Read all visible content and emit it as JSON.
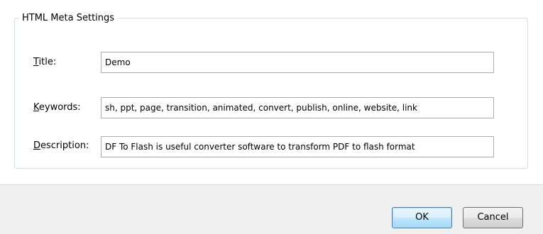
{
  "group": {
    "legend": "HTML Meta Settings"
  },
  "fields": {
    "title": {
      "mnemonic": "T",
      "label_rest": "itle:",
      "value": "Demo"
    },
    "keywords": {
      "mnemonic": "K",
      "label_rest": "eywords:",
      "value": "sh, ppt, page, transition, animated, convert, publish, online, website, link"
    },
    "description": {
      "mnemonic": "D",
      "label_rest": "escription:",
      "value": "DF To Flash is useful converter software to transform PDF to flash format"
    }
  },
  "buttons": {
    "ok": "OK",
    "cancel": "Cancel"
  }
}
